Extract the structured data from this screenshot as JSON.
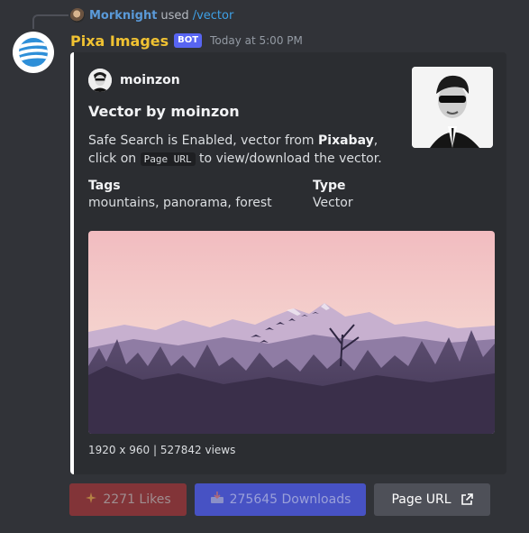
{
  "reply": {
    "username": "Morknight",
    "used_text": "used",
    "command": "/vector"
  },
  "message": {
    "bot_name": "Pixa Images",
    "bot_tag": "BOT",
    "timestamp": "Today at 5:00 PM"
  },
  "embed": {
    "accent_color": "#ffffff",
    "author": "moinzon",
    "title": "Vector by moinzon",
    "description": {
      "part1": "Safe Search is Enabled, vector from ",
      "source": "Pixabay",
      "part2": ", click on ",
      "code": "Page URL",
      "part3": " to view/download the vector."
    },
    "fields": [
      {
        "name": "Tags",
        "value": "mountains, panorama, forest"
      },
      {
        "name": "Type",
        "value": "Vector"
      }
    ],
    "footer": "1920 x 960 | 527842 views"
  },
  "buttons": {
    "likes": {
      "icon": "sparkles-icon",
      "label": "2271 Likes",
      "color": "#823438"
    },
    "downloads": {
      "icon": "inbox-tray-icon",
      "label": "275645 Downloads",
      "color": "#4752c4"
    },
    "page_url": {
      "icon": "external-link-icon",
      "label": "Page URL",
      "color": "#4e5058"
    }
  }
}
